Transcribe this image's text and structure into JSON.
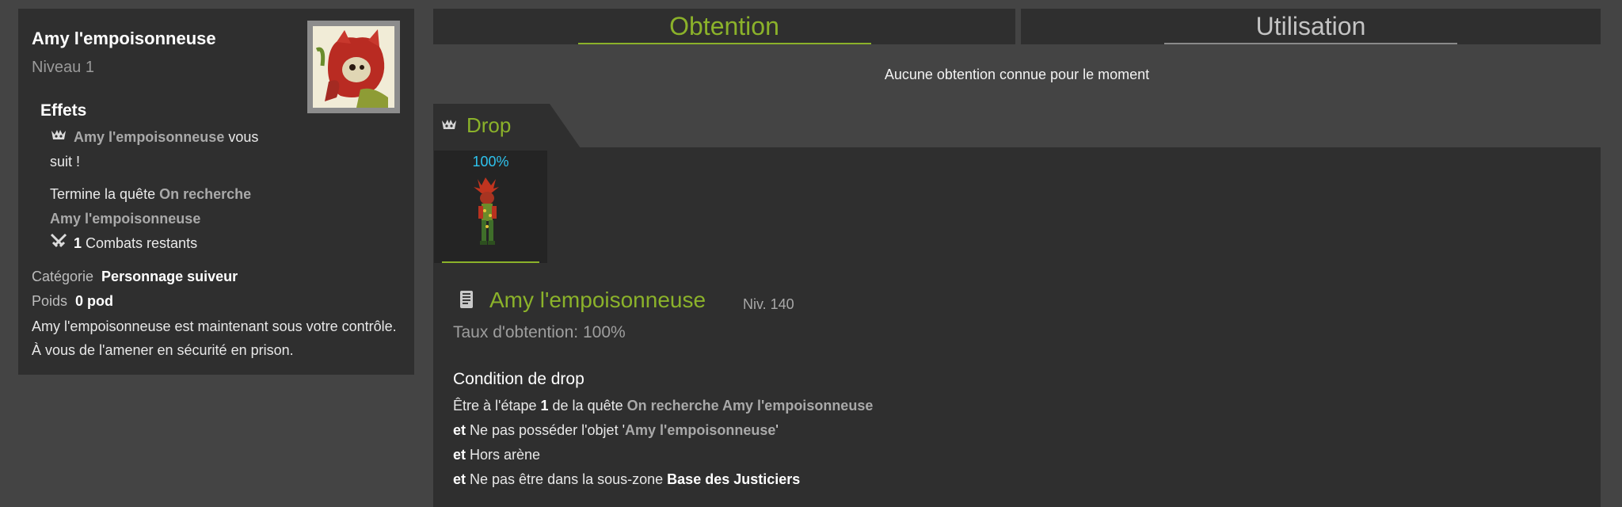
{
  "item": {
    "name": "Amy l'empoisonneuse",
    "level": "Niveau 1",
    "effects_title": "Effets",
    "effects": {
      "follow_name": "Amy l'empoisonneuse",
      "follow_rest": " vous",
      "follow_line2": "suit !",
      "quest_prefix": "Termine la quête ",
      "quest_name_1": "On recherche",
      "quest_name_2": "Amy l'empoisonneuse",
      "fights_count": "1",
      "fights_label": " Combats restants"
    },
    "category_label": "Catégorie",
    "category_value": "Personnage suiveur",
    "weight_label": "Poids",
    "weight_value": "0 pod",
    "description": "Amy l'empoisonneuse est maintenant sous votre contrôle. À vous de l'amener en sécurité en prison."
  },
  "tabs": {
    "obtention": "Obtention",
    "utilisation": "Utilisation"
  },
  "no_obtention_text": "Aucune obtention connue pour le moment",
  "drop": {
    "tab_label": "Drop",
    "percent": "100%",
    "monster_name": "Amy l'empoisonneuse",
    "monster_level": "Niv. 140",
    "rate": "Taux d'obtention: 100%",
    "condition_title": "Condition de drop",
    "conditions": {
      "c1_prefix": "Être à l'étape ",
      "c1_step": "1",
      "c1_mid": " de la quête ",
      "c1_quest": "On recherche Amy l'empoisonneuse",
      "c2_et": "et",
      "c2_text": " Ne pas posséder l'objet '",
      "c2_item": "Amy l'empoisonneuse",
      "c2_end": "'",
      "c3_et": "et",
      "c3_text": " Hors arène",
      "c4_et": "et",
      "c4_text": " Ne pas être dans la sous-zone ",
      "c4_zone": "Base des Justiciers"
    }
  },
  "colors": {
    "accent_green": "#8bb22a",
    "percent_blue": "#2ec3ee",
    "panel": "#2f2f2f",
    "background": "#444444"
  },
  "icons": [
    "follower-icon",
    "crossed-swords-icon",
    "monster-skull-icon",
    "card-icon"
  ]
}
